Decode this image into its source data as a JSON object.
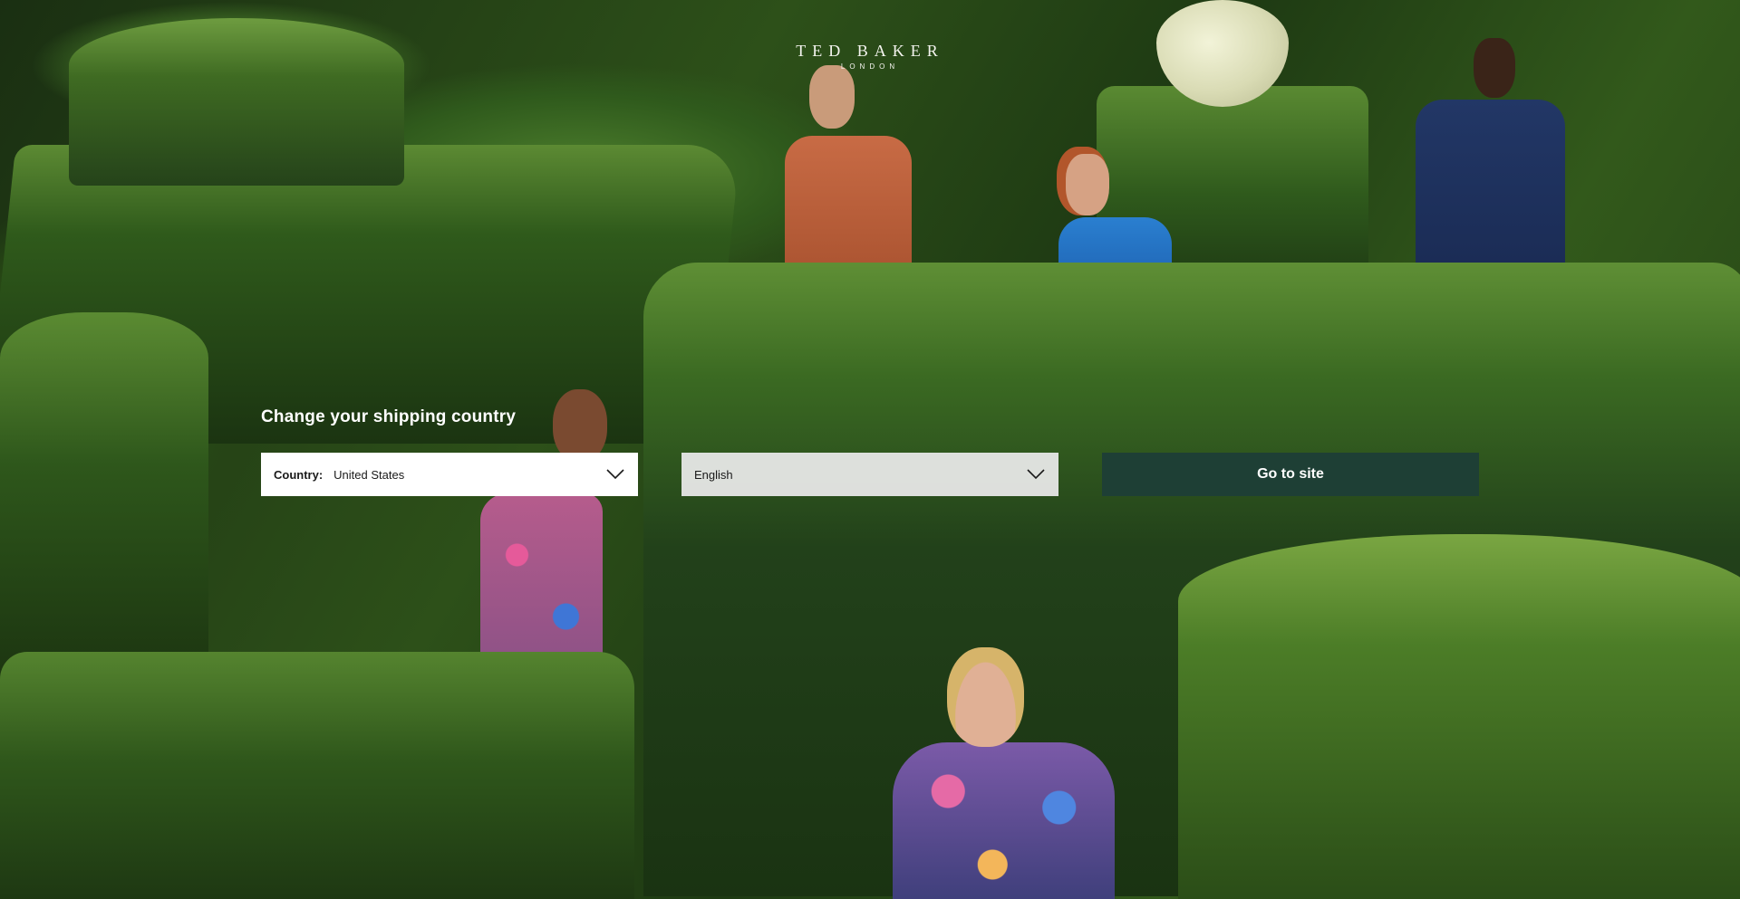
{
  "brand": {
    "name": "TED BAKER",
    "location": "LONDON"
  },
  "form": {
    "title": "Change your shipping country",
    "country": {
      "label": "Country:",
      "value": "United States",
      "icon": "chevron-down-icon"
    },
    "language": {
      "value": "English",
      "icon": "chevron-down-icon"
    },
    "submit_label": "Go to site"
  },
  "colors": {
    "button_bg": "#1e3f35",
    "button_text": "#ffffff",
    "select_bg": "#ffffff",
    "title_text": "#ffffff"
  }
}
